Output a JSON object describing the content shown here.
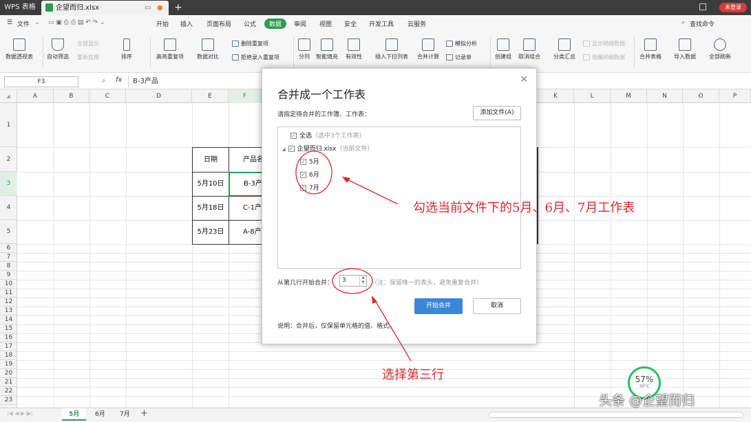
{
  "titlebar": {
    "app": "WPS 表格",
    "doc_tab": "企望而归.xlsx",
    "new_tab": "+",
    "badge": "未登录"
  },
  "menubar": {
    "file": "文件",
    "items": [
      "开始",
      "插入",
      "页面布局",
      "公式",
      "数据",
      "审阅",
      "视图",
      "安全",
      "开发工具",
      "云服务"
    ],
    "active": "数据",
    "search": "查找命令"
  },
  "ribbon": {
    "pivot": "数据透视表",
    "autofilter": "自动筛选",
    "show_all": "全部显示",
    "reapply": "重新应用",
    "sort": "排序",
    "highlight_dup": "高亮重复项",
    "compare": "数据对比",
    "delete_dup": "删除重复项",
    "reject_dup": "拒绝录入重复项",
    "split": "分列",
    "smart_fill": "智能填充",
    "validity": "有效性",
    "dropdown": "插入下拉列表",
    "consolidate": "合并计算",
    "simulate": "模拟分析",
    "record": "记录单",
    "group": "创建组",
    "ungroup": "取消组合",
    "subtotal": "分类汇总",
    "show_detail": "显示明细数据",
    "hide_detail": "隐藏明细数据",
    "merge_table": "合并表格",
    "import": "导入数据",
    "refresh_all": "全部刷新"
  },
  "formula": {
    "cell_ref": "F3",
    "fx": "fx",
    "value": "B-3产品"
  },
  "columns": [
    "A",
    "B",
    "C",
    "D",
    "E",
    "F",
    "K",
    "L",
    "M",
    "N",
    "O",
    "P"
  ],
  "rows": [
    "1",
    "2",
    "3",
    "4",
    "5",
    "6",
    "7",
    "8",
    "9",
    "10",
    "11",
    "12",
    "13",
    "14",
    "15",
    "16",
    "17",
    "18",
    "19",
    "20",
    "21",
    "22",
    "23"
  ],
  "table": {
    "headers": [
      "日期",
      "产品名"
    ],
    "rows": [
      [
        "5月10日",
        "B-3产"
      ],
      [
        "5月18日",
        "C-1产"
      ],
      [
        "5月23日",
        "A-8产"
      ]
    ]
  },
  "sheets": [
    "5月",
    "6月",
    "7月"
  ],
  "dialog": {
    "title": "合并成一个工作表",
    "subtitle": "请指定待合并的工作簿、工作表：",
    "add_file": "添加文件(A)",
    "select_all": "全选",
    "select_all_note": "（选中3个工作表）",
    "workbook": "企望而归.xlsx",
    "workbook_note": "（当前文件）",
    "sheets": [
      "5月",
      "6月",
      "7月"
    ],
    "start_row_label": "从第几行开始合并：",
    "start_row_value": "3",
    "hint": "（注：保留唯一的表头，避免重复合并）",
    "ok": "开始合并",
    "cancel": "取消",
    "note": "说明：合并后，仅保留单元格的值、格式。"
  },
  "annotations": {
    "check_sheets": "勾选当前文件下的5月、6月、7月工作表",
    "select_row": "选择第三行"
  },
  "gauge": {
    "percent": "57%",
    "temp": "30°C"
  },
  "watermark": "头条 @企望而归",
  "colors": {
    "accent": "#2e9b4f",
    "annotation": "#e0262e",
    "primary_button": "#3c86d8"
  }
}
